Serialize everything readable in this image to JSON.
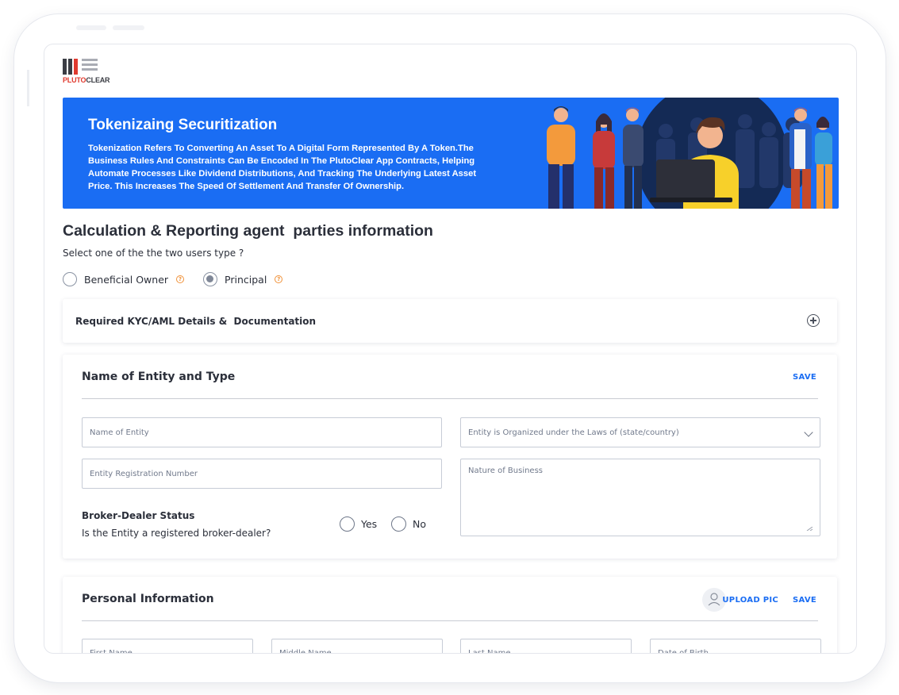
{
  "brand": {
    "logo_primary": "PLUTO",
    "logo_secondary": "CLEAR",
    "accent_color": "#1a6df3",
    "logo_red": "#e03a2f"
  },
  "banner": {
    "title": "Tokenizaing Securitization",
    "description": "Tokenization Refers To Converting An Asset To A Digital Form Represented By A Token.The Business Rules And Constraints Can Be Encoded In The PlutoClear App Contracts, Helping Automate Processes Like Dividend Distributions, And Tracking The Underlying Latest Asset Price. This Increases The Speed Of Settlement And Transfer Of Ownership.",
    "illustration": "people-group-illustration"
  },
  "section": {
    "title": "Calculation & Reporting agent  parties information",
    "question": "Select one of the the two users type ?",
    "user_types": [
      {
        "label": "Beneficial Owner",
        "selected": false,
        "help_icon": "question-circle-icon"
      },
      {
        "label": "Principal",
        "selected": true,
        "help_icon": "question-circle-icon"
      }
    ]
  },
  "kyc": {
    "title": "Required KYC/AML Details &  Documentation",
    "expand_icon": "plus-circle-icon"
  },
  "entity_card": {
    "title": "Name of Entity and Type",
    "save_label": "SAVE",
    "fields": {
      "name_placeholder": "Name of Entity",
      "laws_placeholder": "Entity is Organized under the Laws of (state/country)",
      "registration_placeholder": "Entity Registration Number",
      "nature_placeholder": "Nature of Business"
    },
    "broker_dealer": {
      "title": "Broker-Dealer Status",
      "question": "Is the Entity a registered broker-dealer?",
      "options": [
        {
          "label": "Yes",
          "selected": false
        },
        {
          "label": "No",
          "selected": false
        }
      ]
    }
  },
  "personal_card": {
    "title": "Personal Information",
    "upload_label": "UPLOAD PIC",
    "save_label": "SAVE",
    "avatar_icon": "user-icon",
    "fields": {
      "first_name": "First Name",
      "middle_name": "Middle Name",
      "last_name": "Last Name",
      "dob": "Date of Birth"
    }
  }
}
